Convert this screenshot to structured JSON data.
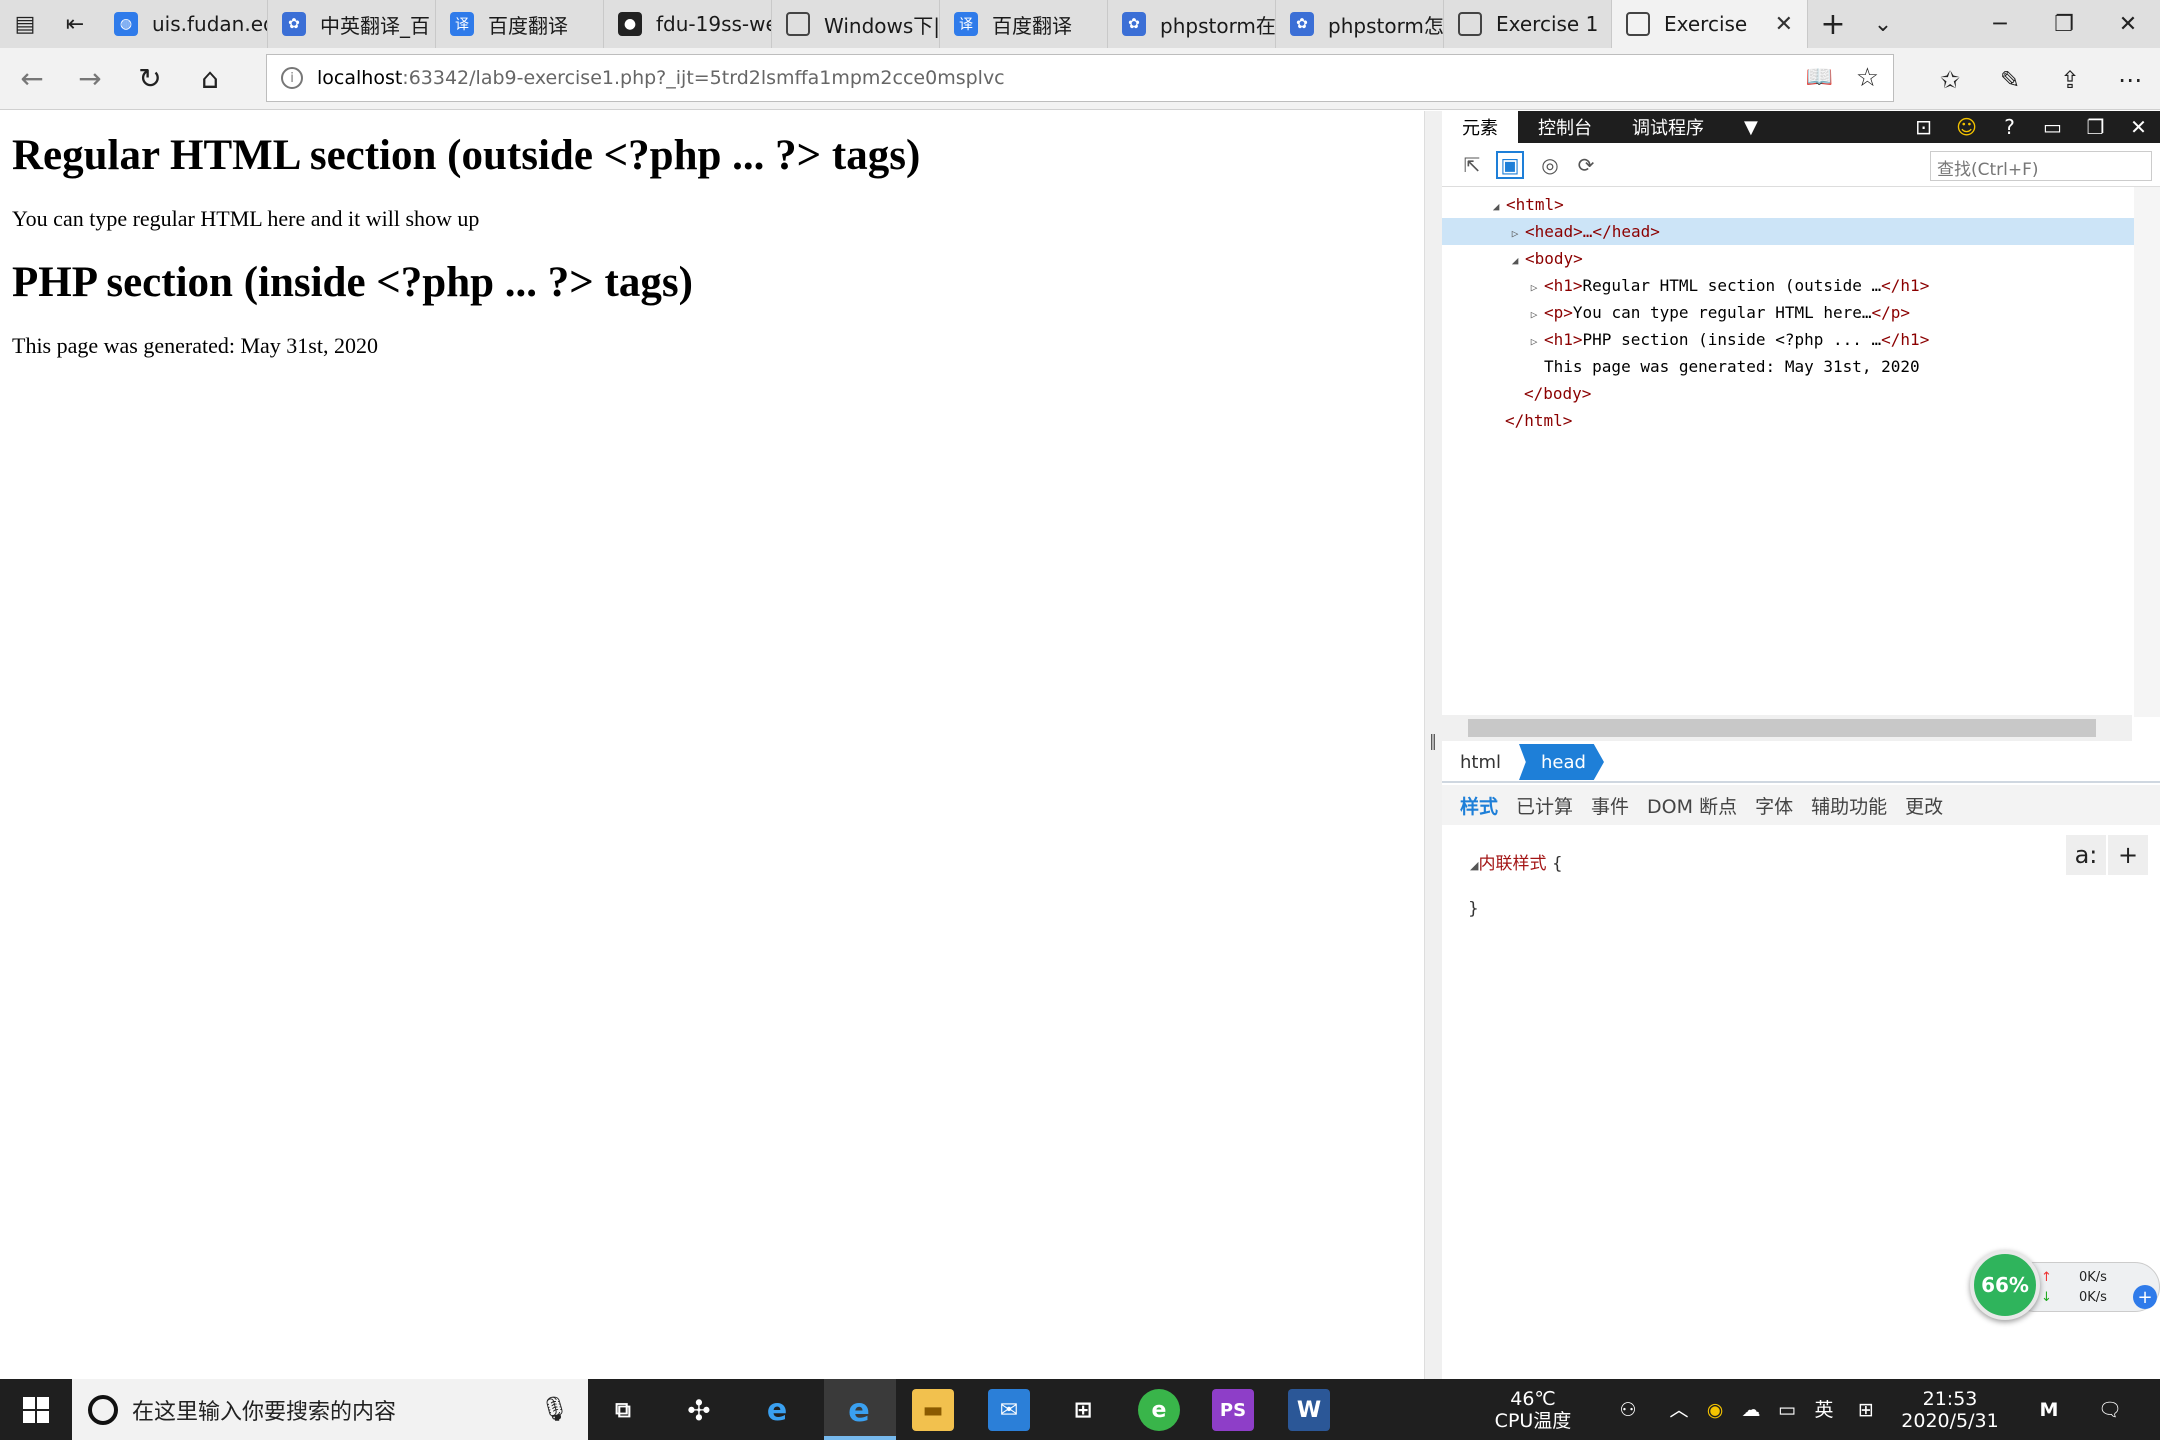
{
  "browser": {
    "tabs": [
      {
        "label": "uis.fudan.ed",
        "icon": "globe-icon"
      },
      {
        "label": "中英翻译_百",
        "icon": "baidu-paw-icon"
      },
      {
        "label": "百度翻译",
        "icon": "baidu-translate-icon"
      },
      {
        "label": "fdu-19ss-we",
        "icon": "github-icon"
      },
      {
        "label": "Windows下|",
        "icon": "page-icon"
      },
      {
        "label": "百度翻译",
        "icon": "baidu-translate-icon"
      },
      {
        "label": "phpstorm在",
        "icon": "baidu-paw-icon"
      },
      {
        "label": "phpstorm怎",
        "icon": "baidu-paw-icon"
      },
      {
        "label": "Exercise 1",
        "icon": "page-icon"
      }
    ],
    "active_tab": {
      "label": "Exercise",
      "icon": "page-icon"
    },
    "url_host": "localhost",
    "url_rest": ":63342/lab9-exercise1.php?_ijt=5trd2lsmffa1mpm2cce0msplvc"
  },
  "page": {
    "h1_a": "Regular HTML section (outside <?php ... ?> tags)",
    "p_a": "You can type regular HTML here and it will show up",
    "h1_b": "PHP section (inside <?php ... ?> tags)",
    "p_b": "This page was generated: May 31st, 2020"
  },
  "devtools": {
    "tabs": [
      "元素",
      "控制台",
      "调试程序"
    ],
    "find_placeholder": "查找(Ctrl+F)",
    "dom": {
      "html_open": "<html>",
      "head": "<head>…</head>",
      "body_open": "<body>",
      "h1a_open": "<h1>",
      "h1a_text": "Regular HTML section (outside …",
      "h1a_close": "</h1>",
      "p_open": "<p>",
      "p_text": "You can type regular HTML here…",
      "p_close": "</p>",
      "h1b_open": "<h1>",
      "h1b_text": "PHP section (inside <?php ... …",
      "h1b_close": "</h1>",
      "text_node": "This page was generated: May 31st, 2020",
      "body_close": "</body>",
      "html_close": "</html>"
    },
    "breadcrumbs": [
      "html",
      "head"
    ],
    "style_tabs": [
      "样式",
      "已计算",
      "事件",
      "DOM 断点",
      "字体",
      "辅助功能",
      "更改"
    ],
    "inline_style_label": "内联样式",
    "brace_open": "{",
    "brace_close": "}",
    "style_btn_a": "a:",
    "style_btn_plus": "+"
  },
  "net_widget": {
    "percent": "66%",
    "up": "0K/s",
    "down": "0K/s"
  },
  "taskbar": {
    "search_placeholder": "在这里输入你要搜索的内容",
    "temp": "46℃",
    "temp_label": "CPU温度",
    "ime": "英",
    "time": "21:53",
    "date": "2020/5/31"
  }
}
